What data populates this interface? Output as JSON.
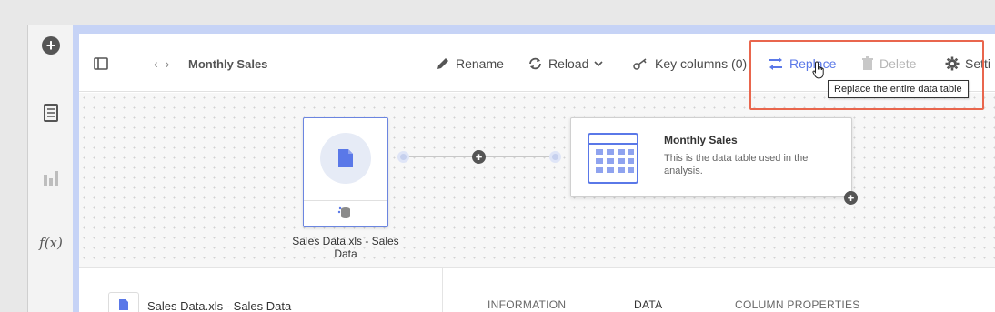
{
  "toolbar": {
    "title": "Monthly Sales",
    "rename_label": "Rename",
    "reload_label": "Reload",
    "key_columns_label": "Key columns (0)",
    "replace_label": "Replace",
    "delete_label": "Delete",
    "settings_label": "Setti"
  },
  "tooltip": {
    "text": "Replace the entire data table"
  },
  "flow": {
    "source": {
      "label": "Sales Data.xls - Sales Data"
    },
    "target": {
      "title": "Monthly Sales",
      "description": "This is the data table used in the analysis."
    }
  },
  "bottom": {
    "file_name": "Sales Data.xls - Sales Data",
    "tabs": {
      "information": "INFORMATION",
      "data": "DATA",
      "column_properties": "COLUMN PROPERTIES"
    }
  },
  "colors": {
    "accent": "#5a78e8",
    "highlight": "#e9664d",
    "panel_border": "#c6d3f6"
  }
}
